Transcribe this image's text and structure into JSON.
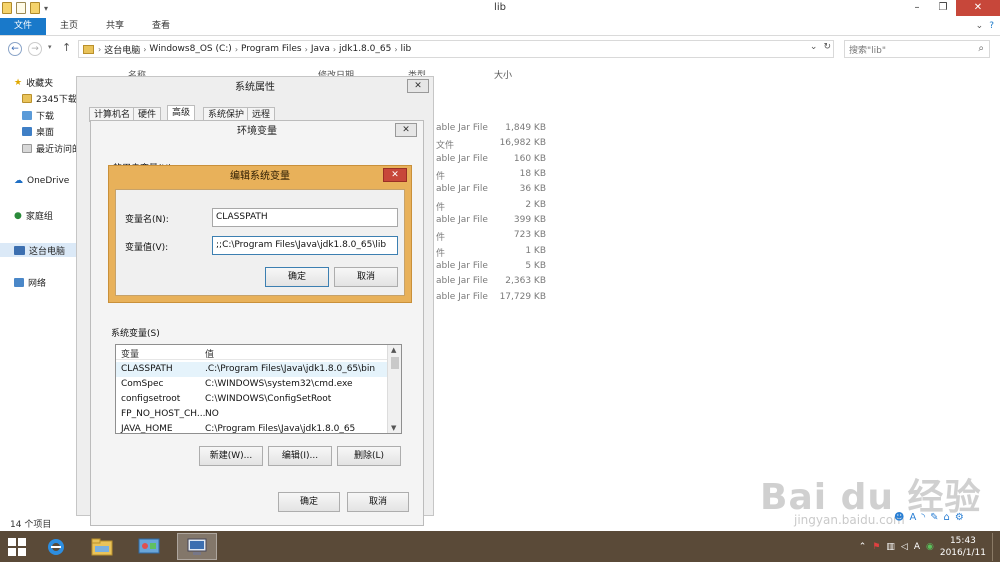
{
  "explorer": {
    "title": "lib",
    "ribbon_tabs": [
      "文件",
      "主页",
      "共享",
      "查看"
    ],
    "breadcrumb": [
      "这台电脑",
      "Windows8_OS (C:)",
      "Program Files",
      "Java",
      "jdk1.8.0_65",
      "lib"
    ],
    "search_placeholder": "搜索\"lib\"",
    "sidebar": {
      "favorites": "收藏夹",
      "fav_items": [
        "2345下载",
        "下载",
        "桌面",
        "最近访问的"
      ],
      "onedrive": "OneDrive",
      "homegroup": "家庭组",
      "thispc": "这台电脑",
      "network": "网络"
    },
    "columns": {
      "name": "名称",
      "modified": "修改日期",
      "type": "类型",
      "size": "大小"
    },
    "files": [
      {
        "type": "able Jar File",
        "size": "1,849 KB"
      },
      {
        "type": "文件",
        "size": "16,982 KB"
      },
      {
        "type": "able Jar File",
        "size": "160 KB"
      },
      {
        "type": "件",
        "size": "18 KB"
      },
      {
        "type": "able Jar File",
        "size": "36 KB"
      },
      {
        "type": "件",
        "size": "2 KB"
      },
      {
        "type": "able Jar File",
        "size": "399 KB"
      },
      {
        "type": "件",
        "size": "723 KB"
      },
      {
        "type": "件",
        "size": "1 KB"
      },
      {
        "type": "able Jar File",
        "size": "5 KB"
      },
      {
        "type": "able Jar File",
        "size": "2,363 KB"
      },
      {
        "type": "able Jar File",
        "size": "17,729 KB"
      }
    ],
    "status": "14 个项目"
  },
  "sysprops": {
    "title": "系统属性",
    "tabs": [
      "计算机名",
      "硬件",
      "高级",
      "系统保护",
      "远程"
    ]
  },
  "envvars": {
    "title": "环境变量",
    "user_label_partial": "的用户变量(U)",
    "system_label": "系统变量(S)",
    "list_headers": {
      "var": "变量",
      "val": "值"
    },
    "rows": [
      {
        "var": "CLASSPATH",
        "val": ".C:\\Program Files\\Java\\jdk1.8.0_65\\bin"
      },
      {
        "var": "ComSpec",
        "val": "C:\\WINDOWS\\system32\\cmd.exe"
      },
      {
        "var": "configsetroot",
        "val": "C:\\WINDOWS\\ConfigSetRoot"
      },
      {
        "var": "FP_NO_HOST_CH...",
        "val": "NO"
      },
      {
        "var": "JAVA_HOME",
        "val": "C:\\Program Files\\Java\\jdk1.8.0_65"
      }
    ],
    "btn_new": "新建(W)...",
    "btn_edit": "编辑(I)...",
    "btn_delete": "删除(L)",
    "btn_ok": "确定",
    "btn_cancel": "取消"
  },
  "editvar": {
    "title": "编辑系统变量",
    "name_label": "变量名(N):",
    "name_value": "CLASSPATH",
    "value_label": "变量值(V):",
    "value_value": ";;C:\\Program Files\\Java\\jdk1.8.0_65\\lib",
    "btn_ok": "确定",
    "btn_cancel": "取消"
  },
  "taskbar": {
    "time": "15:43",
    "date": "2016/1/11",
    "ime": "A"
  },
  "watermark": {
    "text": "Bai du 经验",
    "sub": "jingyan.baidu.com"
  }
}
